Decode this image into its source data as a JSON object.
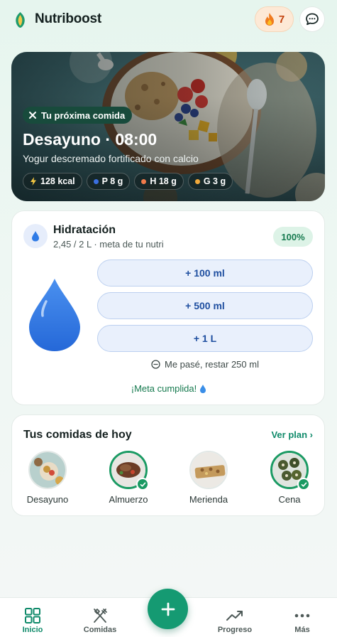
{
  "header": {
    "app_name": "Nutriboost",
    "streak_count": "7"
  },
  "hero": {
    "chip": "Tu próxima comida",
    "title": "Desayuno · 08:00",
    "description": "Yogur descremado fortificado con calcio",
    "macros": [
      {
        "label": "128 kcal",
        "icon": "bolt-icon"
      },
      {
        "label": "P 8 g",
        "color": "#3b6fe0"
      },
      {
        "label": "H 18 g",
        "color": "#f07a4a"
      },
      {
        "label": "G 3 g",
        "color": "#f2a93b"
      }
    ]
  },
  "hydration": {
    "title": "Hidratación",
    "subtitle": "2,45 / 2 L · meta de tu nutri",
    "percent": "100%",
    "buttons": [
      "+ 100 ml",
      "+ 500 ml",
      "+ 1 L"
    ],
    "undo": "Me pasé, restar 250 ml",
    "goal": "¡Meta cumplida!"
  },
  "meals": {
    "title": "Tus comidas de hoy",
    "link": "Ver plan ›",
    "items": [
      {
        "label": "Desayuno",
        "done": false
      },
      {
        "label": "Almuerzo",
        "done": true
      },
      {
        "label": "Merienda",
        "done": false
      },
      {
        "label": "Cena",
        "done": true
      }
    ]
  },
  "nav": {
    "items": [
      "Inicio",
      "Comidas",
      "Progreso",
      "Más"
    ],
    "active": "Inicio"
  },
  "colors": {
    "brand": "#159a72",
    "hydration_blue": "#2f7be6",
    "streak": "#c2410c"
  }
}
